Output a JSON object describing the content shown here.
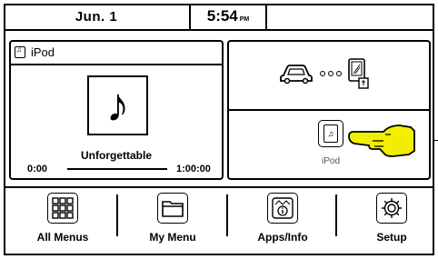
{
  "status_bar": {
    "date": "Jun.  1",
    "time": "5:54",
    "ampm": "PM"
  },
  "now_playing": {
    "source": "iPod",
    "song": "Unforgettable",
    "elapsed": "0:00",
    "duration": "1:00:00",
    "album_art_icon": "music-note-icon"
  },
  "shortcuts": {
    "top_icons": [
      "car-icon",
      "dots-icon",
      "phone-usb-icon"
    ],
    "ipod_label": "iPod"
  },
  "menu": {
    "items": [
      {
        "label": "All Menus",
        "icon": "grid-icon"
      },
      {
        "label": "My Menu",
        "icon": "folder-icon"
      },
      {
        "label": "Apps/Info",
        "icon": "apps-info-icon"
      },
      {
        "label": "Setup",
        "icon": "gear-icon"
      }
    ]
  }
}
